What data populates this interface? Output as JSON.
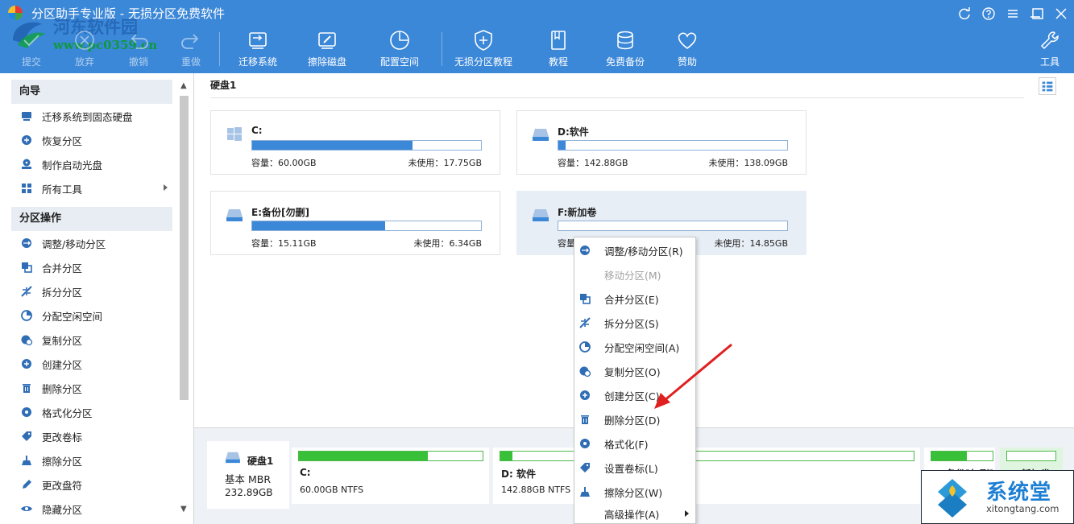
{
  "window": {
    "title": "分区助手专业版 - 无损分区免费软件",
    "watermark": {
      "site_name": "河东软件园",
      "url": "www.pc0359.cn"
    }
  },
  "toolbar": {
    "commit": "提交",
    "discard": "放弃",
    "undo": "撤销",
    "redo": "重做",
    "migrate_os": "迁移系统",
    "wipe_disk": "擦除磁盘",
    "allocate_space": "配置空间",
    "tutorial_lossless": "无损分区教程",
    "tutorial": "教程",
    "free_backup": "免费备份",
    "sponsor": "赞助",
    "tools": "工具"
  },
  "sidebar": {
    "wizard_title": "向导",
    "wizard_items": [
      {
        "label": "迁移系统到固态硬盘",
        "icon": "disk-migrate-icon"
      },
      {
        "label": "恢复分区",
        "icon": "recover-icon"
      },
      {
        "label": "制作启动光盘",
        "icon": "boot-disc-icon"
      },
      {
        "label": "所有工具",
        "icon": "grid-tools-icon"
      }
    ],
    "ops_title": "分区操作",
    "ops_items": [
      {
        "label": "调整/移动分区",
        "icon": "resize-icon"
      },
      {
        "label": "合并分区",
        "icon": "merge-icon"
      },
      {
        "label": "拆分分区",
        "icon": "split-icon"
      },
      {
        "label": "分配空闲空间",
        "icon": "pie-icon"
      },
      {
        "label": "复制分区",
        "icon": "copy-icon"
      },
      {
        "label": "创建分区",
        "icon": "create-icon"
      },
      {
        "label": "删除分区",
        "icon": "trash-icon"
      },
      {
        "label": "格式化分区",
        "icon": "format-icon"
      },
      {
        "label": "更改卷标",
        "icon": "tag-icon"
      },
      {
        "label": "擦除分区",
        "icon": "wipe-icon"
      },
      {
        "label": "更改盘符",
        "icon": "pencil-icon"
      },
      {
        "label": "隐藏分区",
        "icon": "hide-icon"
      }
    ]
  },
  "main": {
    "disk_title": "硬盘1",
    "cap_label": "容量：",
    "free_label": "未使用：",
    "partitions": [
      {
        "name": "C:",
        "capacity": "60.00GB",
        "free": "17.75GB",
        "used_fraction": 0.7
      },
      {
        "name": "D:软件",
        "capacity": "142.88GB",
        "free": "138.09GB",
        "used_fraction": 0.03
      },
      {
        "name": "E:备份[勿删]",
        "capacity": "15.11GB",
        "free": "6.34GB",
        "used_fraction": 0.58
      },
      {
        "name": "F:新加卷",
        "capacity": "",
        "free": "14.85GB",
        "used_fraction": 0.0
      }
    ]
  },
  "bottom": {
    "disk_name": "硬盘1",
    "disk_type": "基本 MBR",
    "disk_size": "232.89GB",
    "parts": [
      {
        "label": "C:",
        "sub": "60.00GB NTFS",
        "used_fraction": 0.7
      },
      {
        "label": "D: 软件",
        "sub": "142.88GB NTFS",
        "used_fraction": 0.03
      },
      {
        "label": "E: 备份[勿删]",
        "sub": "",
        "used_fraction": 0.58
      },
      {
        "label": "F: 新加卷",
        "sub": "",
        "used_fraction": 0.0
      }
    ]
  },
  "context_menu": [
    {
      "label": "调整/移动分区(R)",
      "icon": "resize-icon",
      "enabled": true
    },
    {
      "label": "移动分区(M)",
      "icon": "",
      "enabled": false
    },
    {
      "label": "合并分区(E)",
      "icon": "merge-icon",
      "enabled": true
    },
    {
      "label": "拆分分区(S)",
      "icon": "split-icon",
      "enabled": true
    },
    {
      "label": "分配空闲空间(A)",
      "icon": "pie-icon",
      "enabled": true
    },
    {
      "label": "复制分区(O)",
      "icon": "copy-icon",
      "enabled": true
    },
    {
      "label": "创建分区(C)",
      "icon": "create-icon",
      "enabled": true
    },
    {
      "label": "删除分区(D)",
      "icon": "trash-icon",
      "enabled": true
    },
    {
      "label": "格式化(F)",
      "icon": "format-icon",
      "enabled": true
    },
    {
      "label": "设置卷标(L)",
      "icon": "tag-icon",
      "enabled": true
    },
    {
      "label": "擦除分区(W)",
      "icon": "wipe-icon",
      "enabled": true
    },
    {
      "label": "高级操作(A)",
      "icon": "",
      "enabled": true,
      "submenu": true
    }
  ],
  "badge": {
    "name": "系统堂",
    "url": "xitongtang.com"
  },
  "colors": {
    "accent": "#3b87d8",
    "used_green": "#39c039",
    "arrow": "#e02020"
  }
}
